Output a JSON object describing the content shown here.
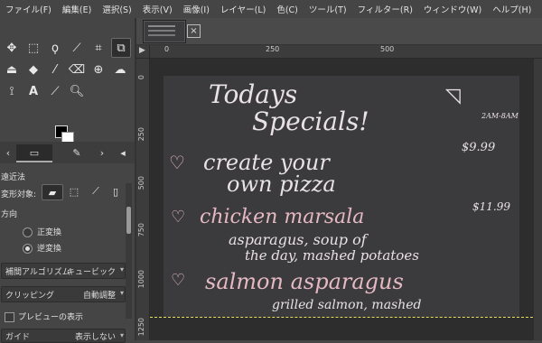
{
  "menu": [
    "ファイル(F)",
    "編集(E)",
    "選択(S)",
    "表示(V)",
    "画像(I)",
    "レイヤー(L)",
    "色(C)",
    "ツール(T)",
    "フィルター(R)",
    "ウィンドウ(W)",
    "ヘルプ(H)"
  ],
  "tool_options": {
    "section_title": "遠近法",
    "transform_label": "変形対象:",
    "direction_label": "方向",
    "forward_label": "正変換",
    "backward_label": "逆変換",
    "interpolation_label": "補間アルゴリズム",
    "interpolation_value": "キュービック",
    "clipping_label": "クリッピング",
    "clipping_value": "自動調整",
    "preview_label": "プレビューの表示",
    "guide_label": "ガイド",
    "guide_value": "表示しない"
  },
  "rulers": {
    "h": [
      "0",
      "250",
      "500"
    ],
    "v": [
      "0",
      "250",
      "500",
      "750",
      "1000",
      "1250"
    ]
  },
  "image": {
    "line1": "Todays",
    "line2": "Specials!",
    "item1a": "create your",
    "item1b": "own pizza",
    "price1": "$9.99",
    "item2": "chicken marsala",
    "item2desc1": "asparagus, soup of",
    "item2desc2": "the day, mashed potatoes",
    "price2": "$11.99",
    "item3": "salmon asparagus",
    "item3desc": "grilled salmon, mashed",
    "corner_note": "2AM-8AM"
  }
}
